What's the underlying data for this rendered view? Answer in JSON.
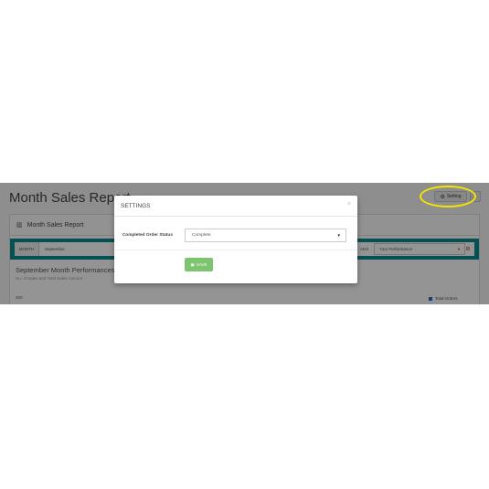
{
  "page": {
    "title": "Month Sales Report",
    "setting_button": "Setting",
    "panel_heading": "Month Sales Report",
    "month_label": "MONTH",
    "month_value": "September",
    "perf_label": "ADS",
    "perf_value": "Your Performance",
    "performance_title": "September Month Performances",
    "performance_subtitle": "No. of Sales and Total Sales Amount",
    "y_axis_top": "300",
    "legend_total_orders": "Total Orders"
  },
  "modal": {
    "title": "SETTINGS",
    "close": "×",
    "field_label": "Completed Order Status",
    "select_value": "Complete",
    "save_label": "SAVE"
  },
  "icons": {
    "gear": "gear-icon",
    "chart": "bar-chart-icon",
    "save": "floppy-disk-icon",
    "caret": "caret-down-icon"
  },
  "colors": {
    "filter_bar": "#0a8a8f",
    "save_button": "#7cc46d",
    "highlight": "#f2e600",
    "legend_series": "#1f6fc5"
  }
}
